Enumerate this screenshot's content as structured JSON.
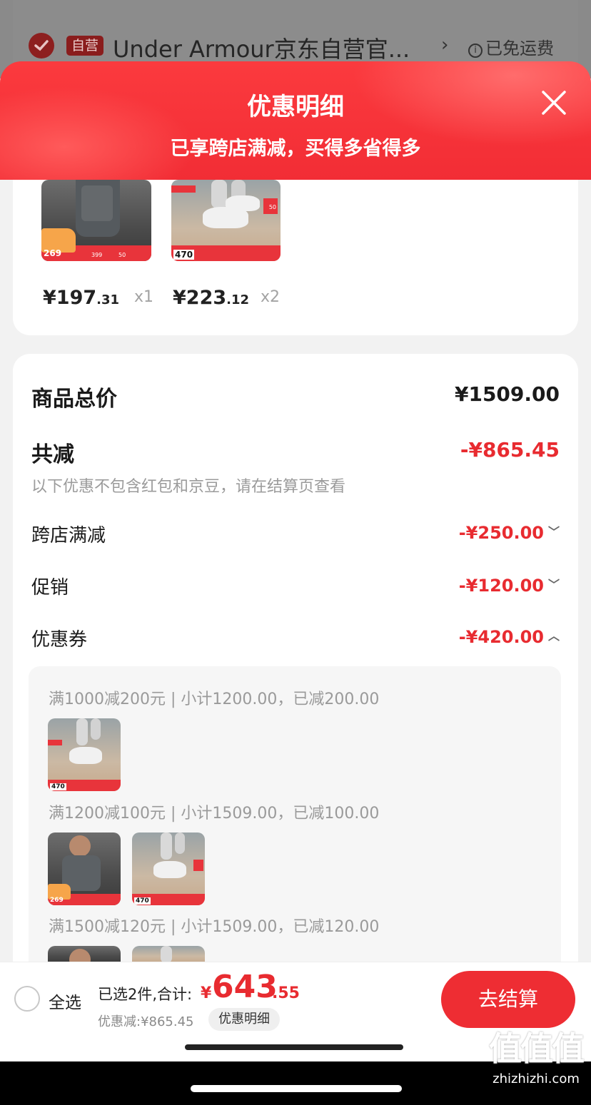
{
  "store": {
    "badge": "自营",
    "name": "Under Armour京东自营官...",
    "arrow": "›",
    "shipping": "已免运费",
    "info_icon": "i"
  },
  "banner": {
    "title": "优惠明细",
    "subtitle": "已享跨店满减，买得多省得多"
  },
  "products": [
    {
      "image": "t-shirt",
      "price_int": "¥197",
      "price_dec": ".31",
      "qty": "x1",
      "promo_tag": "269",
      "strip_nums": [
        "399",
        "50"
      ]
    },
    {
      "image": "sneaker",
      "price_int": "¥223",
      "price_dec": ".12",
      "qty": "x2",
      "promo_tag": "470",
      "side_tag": "50"
    }
  ],
  "summary": {
    "total_label": "商品总价",
    "total_value": "¥1509.00",
    "reduced_label": "共减",
    "reduced_value": "-¥865.45",
    "note": "以下优惠不包含红包和京豆，请在结算页查看",
    "rows": [
      {
        "label": "跨店满减",
        "value": "-¥250.00",
        "chevron": "﹀"
      },
      {
        "label": "促销",
        "value": "-¥120.00",
        "chevron": "﹀"
      },
      {
        "label": "优惠券",
        "value": "-¥420.00",
        "chevron": "︿"
      }
    ]
  },
  "coupons": [
    {
      "text": "满1000减200元 | 小计1200.00，已减200.00",
      "items": [
        "sneaker"
      ]
    },
    {
      "text": "满1200减100元 | 小计1509.00，已减100.00",
      "items": [
        "t-shirt",
        "sneaker"
      ]
    },
    {
      "text": "满1500减120元 | 小计1509.00，已减120.00",
      "items": [
        "t-shirt",
        "sneaker"
      ]
    }
  ],
  "bottom_bar": {
    "select_all": "全选",
    "summary_prefix": "已选2件,合计:",
    "yen": "¥",
    "total_int": "643",
    "total_dec": ".55",
    "discount": "优惠减:¥865.45",
    "detail_button": "优惠明细",
    "checkout": "去结算"
  },
  "watermark": {
    "logo": "值值值",
    "url": "zhizhizhi.com"
  },
  "colors": {
    "accent_red": "#e82b30",
    "banner_red": "#f22d35"
  }
}
